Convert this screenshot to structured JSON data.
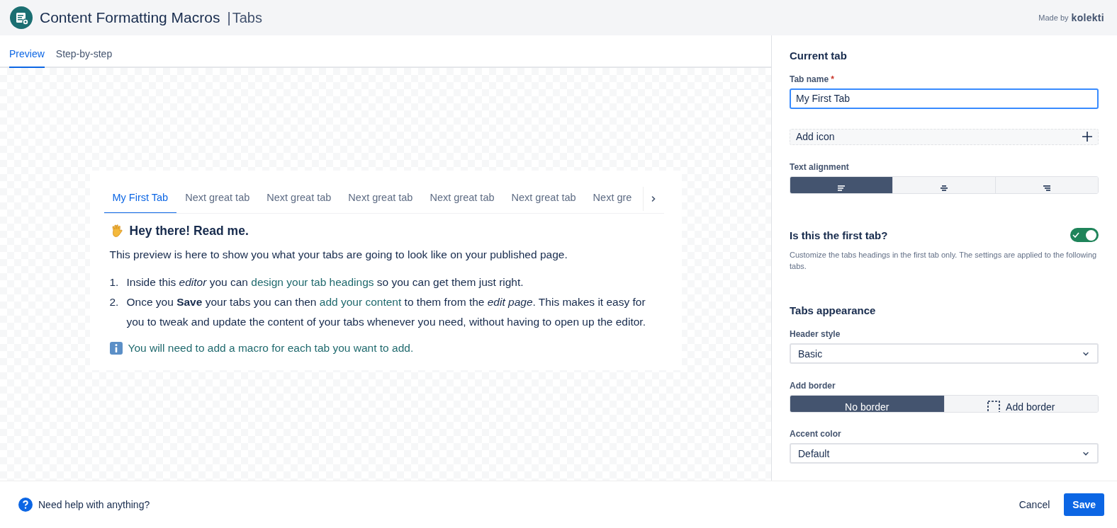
{
  "header": {
    "title": "Content Formatting Macros",
    "separator": "|",
    "subtitle": "Tabs",
    "made_by": "Made by",
    "brand": "kolekti"
  },
  "view_tabs": [
    {
      "label": "Preview",
      "selected": true
    },
    {
      "label": "Step-by-step",
      "selected": false
    }
  ],
  "preview": {
    "tabs": [
      {
        "label": "My First Tab",
        "selected": true
      },
      {
        "label": "Next great tab",
        "selected": false
      },
      {
        "label": "Next great tab",
        "selected": false
      },
      {
        "label": "Next great tab",
        "selected": false
      },
      {
        "label": "Next great tab",
        "selected": false
      },
      {
        "label": "Next great tab",
        "selected": false
      },
      {
        "label": "Next gre",
        "selected": false
      }
    ],
    "heading": "Hey there! Read me.",
    "intro": "This preview is here to show you what your tabs are going to look like on your published page.",
    "steps": [
      {
        "number": "1.",
        "parts": [
          {
            "kind": "text",
            "text": "Inside this *editor* you can "
          },
          {
            "kind": "link",
            "text": "design your tab headings"
          },
          {
            "kind": "text",
            "text": " so you can get them just right."
          }
        ]
      },
      {
        "number": "2.",
        "parts": [
          {
            "kind": "text",
            "text": "Once you **Save** your tabs you can then "
          },
          {
            "kind": "link",
            "text": "add your content"
          },
          {
            "kind": "text",
            "text": " to them from the *edit page*. This makes it easy for you to tweak and update the content of your tabs whenever you need, without having to open up the editor."
          }
        ]
      }
    ],
    "note": "You will need to add a macro for each tab you want to add."
  },
  "settings": {
    "section_title": "Current tab",
    "tab_name": {
      "label": "Tab name",
      "required_mark": "*",
      "value": "My First Tab"
    },
    "add_icon": {
      "label": "Add icon"
    },
    "text_alignment": {
      "label": "Text alignment",
      "options": [
        {
          "kind": "left",
          "selected": true
        },
        {
          "kind": "center",
          "selected": false
        },
        {
          "kind": "right",
          "selected": false
        }
      ]
    },
    "first_tab": {
      "label": "Is this the first tab?",
      "on": true,
      "help": "Customize the tabs headings in the first tab only. The settings are applied to the following tabs."
    },
    "appearance_title": "Tabs appearance",
    "header_style": {
      "label": "Header style",
      "value": "Basic"
    },
    "add_border": {
      "label": "Add border",
      "options": [
        {
          "kind": "none",
          "label": "No border",
          "selected": true
        },
        {
          "kind": "dashed",
          "label": "Add border",
          "selected": false
        }
      ]
    },
    "accent_color": {
      "label": "Accent color",
      "value": "Default"
    }
  },
  "footer": {
    "help": "Need help with anything?",
    "buttons": [
      {
        "kind": "secondary",
        "label": "Cancel"
      },
      {
        "kind": "primary",
        "label": "Save"
      }
    ]
  }
}
